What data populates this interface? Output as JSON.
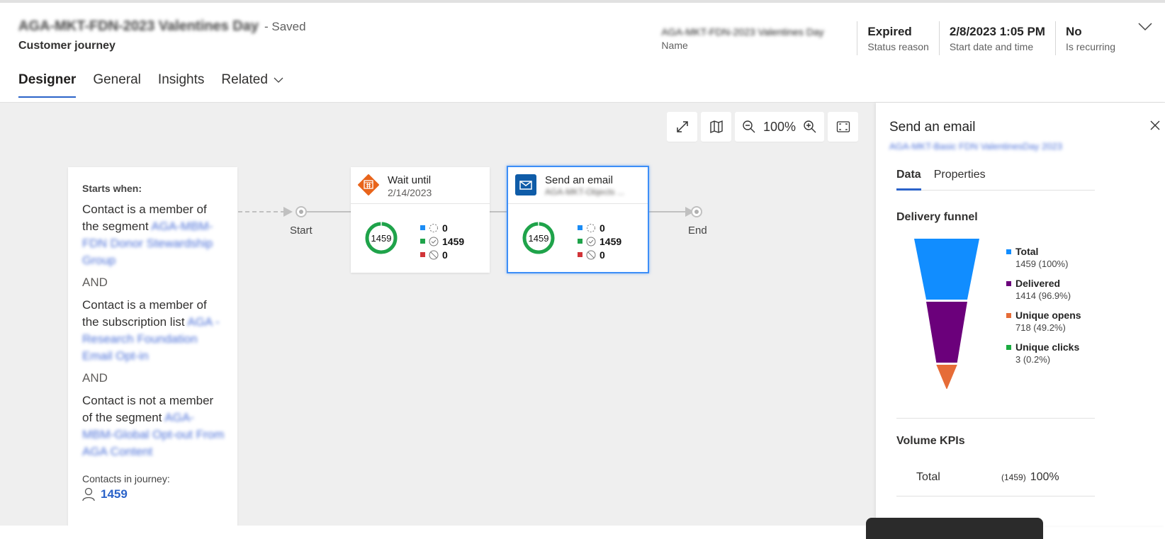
{
  "header": {
    "record_title": "AGA-MKT-FDN-2023 Valentines Day",
    "saved_status": "- Saved",
    "entity_type": "Customer journey",
    "tabs": [
      {
        "label": "Designer",
        "active": true
      },
      {
        "label": "General",
        "active": false
      },
      {
        "label": "Insights",
        "active": false
      },
      {
        "label": "Related",
        "active": false,
        "has_dropdown": true
      }
    ],
    "fields": [
      {
        "value": "AGA-MKT-FDN-2023 Valentines Day",
        "label": "Name",
        "blurred": true
      },
      {
        "value": "Expired",
        "label": "Status reason"
      },
      {
        "value": "2/8/2023 1:05 PM",
        "label": "Start date and time"
      },
      {
        "value": "No",
        "label": "Is recurring"
      }
    ]
  },
  "toolbar": {
    "expand_icon": "expand-diagonal-icon",
    "map_icon": "map-icon",
    "zoom_level": "100%",
    "fit_icon": "fit-screen-icon"
  },
  "trigger": {
    "starts_when": "Starts when:",
    "conditions": [
      {
        "text": "Contact is a member of the segment",
        "ref": "AGA-MBM-FDN Donor Stewardship Group"
      },
      {
        "text": "Contact is a member of the subscription list",
        "ref": "AGA - Research Foundation Email Opt-in"
      },
      {
        "text": "Contact is not a member of the segment",
        "ref": "AGA-MBM-Global Opt-out From AGA Content"
      }
    ],
    "joiner": "AND",
    "contacts_label": "Contacts in journey:",
    "contacts_count": "1459"
  },
  "flow": {
    "start_label": "Start",
    "end_label": "End",
    "tiles": [
      {
        "title": "Wait until",
        "subtitle": "2/14/2023",
        "icon": "calendar-icon",
        "icon_color": "#e8641b",
        "total": "1459",
        "stats": [
          {
            "icon": "pending-icon",
            "color": "#1b8cf5",
            "value": "0"
          },
          {
            "icon": "check-circle-icon",
            "color": "#1fa34a",
            "value": "1459"
          },
          {
            "icon": "blocked-icon",
            "color": "#d13438",
            "value": "0"
          }
        ]
      },
      {
        "title": "Send an email",
        "subtitle": "AGA-MKT-Objects ...",
        "icon": "mail-icon",
        "icon_color": "#0f5ca8",
        "selected": true,
        "total": "1459",
        "stats": [
          {
            "icon": "pending-icon",
            "color": "#1b8cf5",
            "value": "0"
          },
          {
            "icon": "check-circle-icon",
            "color": "#1fa34a",
            "value": "1459"
          },
          {
            "icon": "blocked-icon",
            "color": "#d13438",
            "value": "0"
          }
        ]
      }
    ]
  },
  "panel": {
    "title": "Send an email",
    "subtitle": "AGA-MKT-Basic FDN ValentinesDay 2023",
    "tabs": [
      {
        "label": "Data",
        "active": true
      },
      {
        "label": "Properties",
        "active": false
      }
    ],
    "funnel_title": "Delivery funnel",
    "kpi_title": "Volume KPIs",
    "kpis": [
      {
        "name": "Total",
        "count": "(1459)",
        "pct": "100%"
      }
    ]
  },
  "chart_data": {
    "type": "funnel",
    "title": "Delivery funnel",
    "categories": [
      "Total",
      "Delivered",
      "Unique opens",
      "Unique clicks"
    ],
    "values": [
      1459,
      1414,
      718,
      3
    ],
    "percent_labels": [
      "1459 (100%)",
      "1414 (96.9%)",
      "718 (49.2%)",
      "3 (0.2%)"
    ],
    "colors": [
      "#118dff",
      "#6b007b",
      "#e66c37",
      "#1aab40"
    ],
    "legend_position": "right"
  }
}
